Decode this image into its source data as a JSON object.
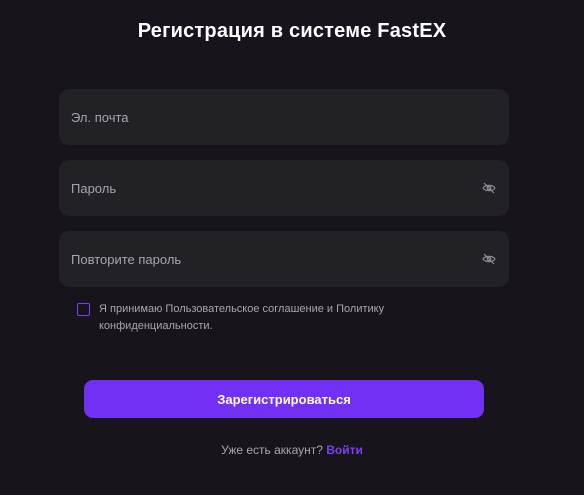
{
  "form": {
    "title": "Регистрация в системе FastEX",
    "email": {
      "value": "",
      "placeholder": "Эл. почта"
    },
    "password": {
      "value": "",
      "placeholder": "Пароль",
      "toggle_icon": "eye-off-icon"
    },
    "confirm_password": {
      "value": "",
      "placeholder": "Повторите пароль",
      "toggle_icon": "eye-off-icon"
    },
    "agreement": {
      "checked": false,
      "label": "Я принимаю Пользовательское соглашение и Политику конфиденциальности."
    },
    "submit_label": "Зарегистрироваться",
    "login_prompt": "Уже есть аккаунт?",
    "login_link": "Войти"
  },
  "colors": {
    "background": "#17151b",
    "field_background": "#222126",
    "accent": "#7330f5",
    "muted_text": "#a8a5ae"
  }
}
